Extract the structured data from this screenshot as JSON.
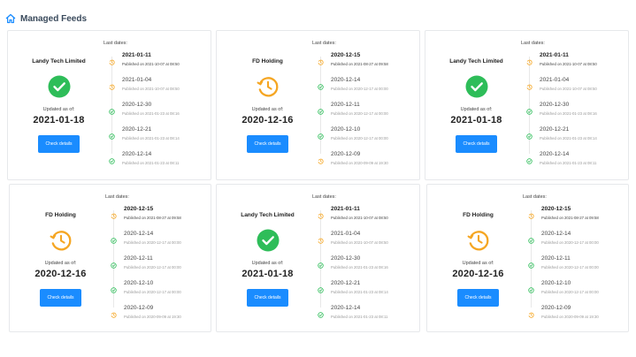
{
  "page": {
    "title": "Managed Feeds"
  },
  "labels": {
    "updated_as_of": "Updated as of:",
    "last_dates": "Last dates:",
    "check_details": "Check details"
  },
  "colors": {
    "ok": "#2ebd59",
    "warn": "#f5a623",
    "accent": "#1a8cff"
  },
  "cards": [
    {
      "company": "Landy Tech Limited",
      "status": "ok",
      "status_icon": "check-circle-icon",
      "updated": "2021-01-18",
      "entries": [
        {
          "date": "2021-01-11",
          "published": "Published on 2021-10-07 at 08:50",
          "status": "warn"
        },
        {
          "date": "2021-01-04",
          "published": "Published on 2021-10-07 at 08:50",
          "status": "warn"
        },
        {
          "date": "2020-12-30",
          "published": "Published on 2021-01-23 at 08:16",
          "status": "ok"
        },
        {
          "date": "2020-12-21",
          "published": "Published on 2021-01-23 at 08:14",
          "status": "ok"
        },
        {
          "date": "2020-12-14",
          "published": "Published on 2021-01-23 at 08:11",
          "status": "ok"
        }
      ]
    },
    {
      "company": "FD Holding",
      "status": "warn",
      "status_icon": "clock-history-icon",
      "updated": "2020-12-16",
      "entries": [
        {
          "date": "2020-12-15",
          "published": "Published on 2021-08-27 at 09:58",
          "status": "warn"
        },
        {
          "date": "2020-12-14",
          "published": "Published on 2020-12-17 at 00:00",
          "status": "ok"
        },
        {
          "date": "2020-12-11",
          "published": "Published on 2020-12-17 at 00:00",
          "status": "ok"
        },
        {
          "date": "2020-12-10",
          "published": "Published on 2020-12-17 at 00:00",
          "status": "ok"
        },
        {
          "date": "2020-12-09",
          "published": "Published on 2020-09-09 at 19:30",
          "status": "warn"
        }
      ]
    },
    {
      "company": "Landy Tech Limited",
      "status": "ok",
      "status_icon": "check-circle-icon",
      "updated": "2021-01-18",
      "entries": [
        {
          "date": "2021-01-11",
          "published": "Published on 2021-10-07 at 08:50",
          "status": "warn"
        },
        {
          "date": "2021-01-04",
          "published": "Published on 2021-10-07 at 08:50",
          "status": "warn"
        },
        {
          "date": "2020-12-30",
          "published": "Published on 2021-01-23 at 08:16",
          "status": "ok"
        },
        {
          "date": "2020-12-21",
          "published": "Published on 2021-01-23 at 08:14",
          "status": "ok"
        },
        {
          "date": "2020-12-14",
          "published": "Published on 2021-01-23 at 08:11",
          "status": "ok"
        }
      ]
    },
    {
      "company": "FD Holding",
      "status": "warn",
      "status_icon": "clock-history-icon",
      "updated": "2020-12-16",
      "entries": [
        {
          "date": "2020-12-15",
          "published": "Published on 2021-08-27 at 09:58",
          "status": "warn"
        },
        {
          "date": "2020-12-14",
          "published": "Published on 2020-12-17 at 00:00",
          "status": "ok"
        },
        {
          "date": "2020-12-11",
          "published": "Published on 2020-12-17 at 00:00",
          "status": "ok"
        },
        {
          "date": "2020-12-10",
          "published": "Published on 2020-12-17 at 00:00",
          "status": "ok"
        },
        {
          "date": "2020-12-09",
          "published": "Published on 2020-09-09 at 19:30",
          "status": "warn"
        }
      ]
    },
    {
      "company": "Landy Tech Limited",
      "status": "ok",
      "status_icon": "check-circle-icon",
      "updated": "2021-01-18",
      "entries": [
        {
          "date": "2021-01-11",
          "published": "Published on 2021-10-07 at 08:50",
          "status": "warn"
        },
        {
          "date": "2021-01-04",
          "published": "Published on 2021-10-07 at 08:50",
          "status": "warn"
        },
        {
          "date": "2020-12-30",
          "published": "Published on 2021-01-23 at 08:16",
          "status": "ok"
        },
        {
          "date": "2020-12-21",
          "published": "Published on 2021-01-23 at 08:14",
          "status": "ok"
        },
        {
          "date": "2020-12-14",
          "published": "Published on 2021-01-23 at 08:11",
          "status": "ok"
        }
      ]
    },
    {
      "company": "FD Holding",
      "status": "warn",
      "status_icon": "clock-history-icon",
      "updated": "2020-12-16",
      "entries": [
        {
          "date": "2020-12-15",
          "published": "Published on 2021-08-27 at 09:58",
          "status": "warn"
        },
        {
          "date": "2020-12-14",
          "published": "Published on 2020-12-17 at 00:00",
          "status": "ok"
        },
        {
          "date": "2020-12-11",
          "published": "Published on 2020-12-17 at 00:00",
          "status": "ok"
        },
        {
          "date": "2020-12-10",
          "published": "Published on 2020-12-17 at 00:00",
          "status": "ok"
        },
        {
          "date": "2020-12-09",
          "published": "Published on 2020-09-09 at 19:30",
          "status": "warn"
        }
      ]
    }
  ]
}
